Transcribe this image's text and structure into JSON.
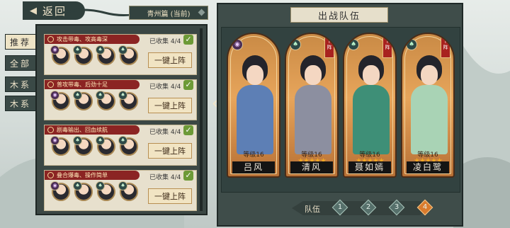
{
  "back_button": {
    "label": "返回"
  },
  "region": {
    "label": "青州篇 (当前)"
  },
  "filters": [
    "推荐",
    "全部",
    "木系",
    "木系"
  ],
  "team_rows": [
    {
      "title": "攻击带毒、攻高毒深",
      "collected": "已收集 4/4",
      "button": "一键上阵"
    },
    {
      "title": "普攻带毒、后劲十足",
      "collected": "已收集 4/4",
      "button": "一键上阵"
    },
    {
      "title": "剧毒输出、回血续航",
      "collected": "已收集 4/4",
      "button": "一键上阵"
    },
    {
      "title": "叠合爆毒、操作简单",
      "collected": "已收集 4/4",
      "button": "一键上阵"
    }
  ],
  "panel_title": "出战队伍",
  "unit_labels": {
    "level": "等级16",
    "remove": "下阵"
  },
  "cards": [
    {
      "name": "吕风",
      "level": "等级16",
      "stars": "",
      "element": "purple",
      "removable": false,
      "robe": "#5d7fb5"
    },
    {
      "name": "清风",
      "level": "等级16",
      "stars": "★★★★★",
      "element": "green",
      "removable": true,
      "robe": "#8c8fa0"
    },
    {
      "name": "聂如嫣",
      "level": "等级16",
      "stars": "★★★★★",
      "element": "green",
      "removable": true,
      "robe": "#3e8f77"
    },
    {
      "name": "凌白鹭",
      "level": "等级16",
      "stars": "★★★★★",
      "element": "green",
      "removable": true,
      "robe": "#a9d3b5"
    }
  ],
  "team_selector": {
    "label": "队伍",
    "slots": [
      "1",
      "2",
      "3",
      "4"
    ],
    "selected": "4"
  },
  "colors": {
    "accent_red": "#8b2423",
    "panel": "#3b4744",
    "card_gold": "#e7a55b"
  }
}
